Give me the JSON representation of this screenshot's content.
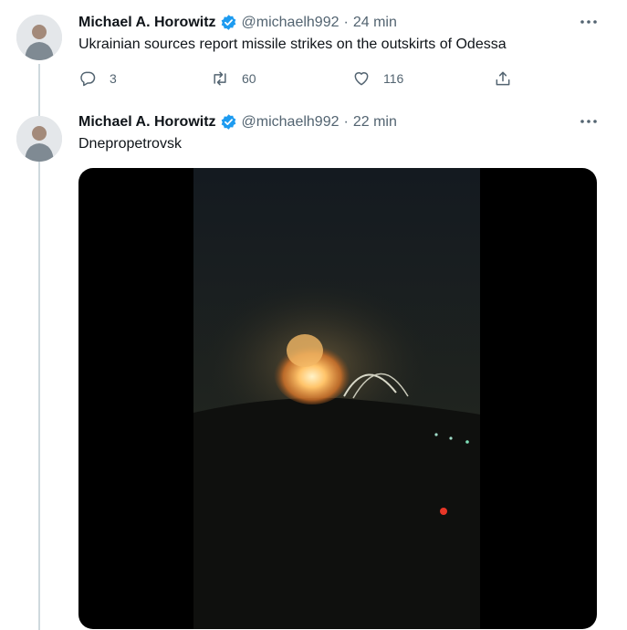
{
  "tweets": [
    {
      "author_name": "Michael A. Horowitz",
      "handle": "@michaelh992",
      "separator": "·",
      "time": "24 min",
      "text": "Ukrainian sources report missile strikes on the outskirts of Odessa",
      "reply_count": "3",
      "retweet_count": "60",
      "like_count": "116"
    },
    {
      "author_name": "Michael A. Horowitz",
      "handle": "@michaelh992",
      "separator": "·",
      "time": "22 min",
      "text": "Dnepropetrovsk"
    }
  ],
  "icons": {
    "more": "more-horizontal-icon",
    "verified": "verified-badge-icon",
    "reply": "reply-icon",
    "retweet": "retweet-icon",
    "like": "heart-icon",
    "share": "share-icon"
  },
  "colors": {
    "text_primary": "#0f1419",
    "text_secondary": "#536471",
    "verified_blue": "#1d9bf0",
    "thread_line": "#cfd9de"
  }
}
